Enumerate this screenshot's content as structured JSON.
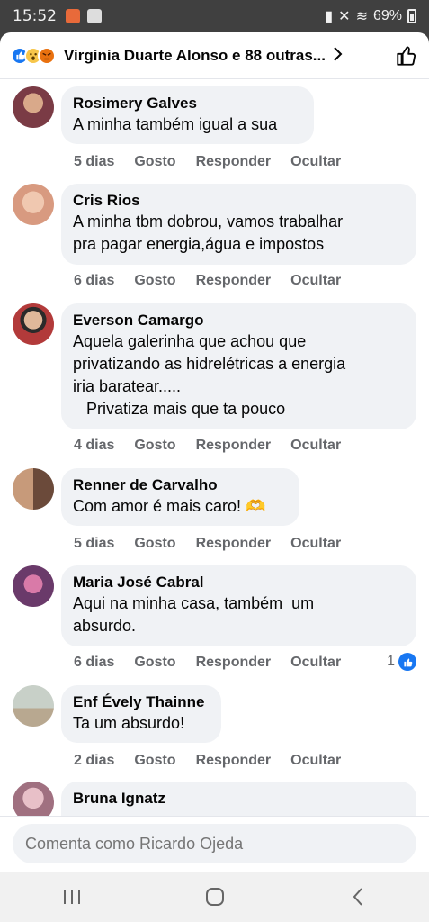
{
  "status_bar": {
    "time": "15:52",
    "battery": "69%"
  },
  "header": {
    "title": "Virginia Duarte Alonso e 88 outras..."
  },
  "comments": [
    {
      "name": "Rosimery Galves",
      "text": "A minha também igual a sua",
      "time": "5 dias",
      "like": "Gosto",
      "reply": "Responder",
      "hide": "Ocultar",
      "avatar_color": "#b76e79"
    },
    {
      "name": "Cris Rios",
      "text": "A minha tbm dobrou, vamos trabalhar\npra pagar energia,água e impostos",
      "time": "6 dias",
      "like": "Gosto",
      "reply": "Responder",
      "hide": "Ocultar",
      "avatar_color": "#e8b49a"
    },
    {
      "name": "Everson Camargo",
      "text": "Aquela galerinha que achou que\nprivatizando as hidrelétricas a energia\niria baratear.....\n   Privatiza mais que ta pouco",
      "time": "4 dias",
      "like": "Gosto",
      "reply": "Responder",
      "hide": "Ocultar",
      "avatar_color": "#a13a3a"
    },
    {
      "name": "Renner de Carvalho",
      "text": "Com amor é mais caro! 🫶",
      "time": "5 dias",
      "like": "Gosto",
      "reply": "Responder",
      "hide": "Ocultar",
      "avatar_color": "#8a6a50"
    },
    {
      "name": "Maria José Cabral",
      "text": "Aqui na minha casa, também  um\nabsurdo.",
      "time": "6 dias",
      "like": "Gosto",
      "reply": "Responder",
      "hide": "Ocultar",
      "likes": "1",
      "avatar_color": "#b05a8a"
    },
    {
      "name": "Enf Évely Thainne",
      "text": "Ta um absurdo!",
      "time": "2 dias",
      "like": "Gosto",
      "reply": "Responder",
      "hide": "Ocultar",
      "avatar_color": "#9fa89a"
    },
    {
      "name": "Bruna Ignatz",
      "text": "",
      "time": "",
      "like": "",
      "reply": "",
      "hide": "",
      "avatar_color": "#c9a0a8"
    }
  ],
  "composer": {
    "placeholder": "Comenta como Ricardo Ojeda"
  },
  "colors": {
    "accent": "#1877f2",
    "bubble": "#f0f2f5",
    "muted": "#65676b"
  },
  "icons": [
    "like-reaction-icon",
    "wow-reaction-icon",
    "angry-reaction-icon",
    "chevron-right-icon",
    "thumbs-up-icon",
    "recent-apps-icon",
    "home-icon",
    "back-icon"
  ]
}
